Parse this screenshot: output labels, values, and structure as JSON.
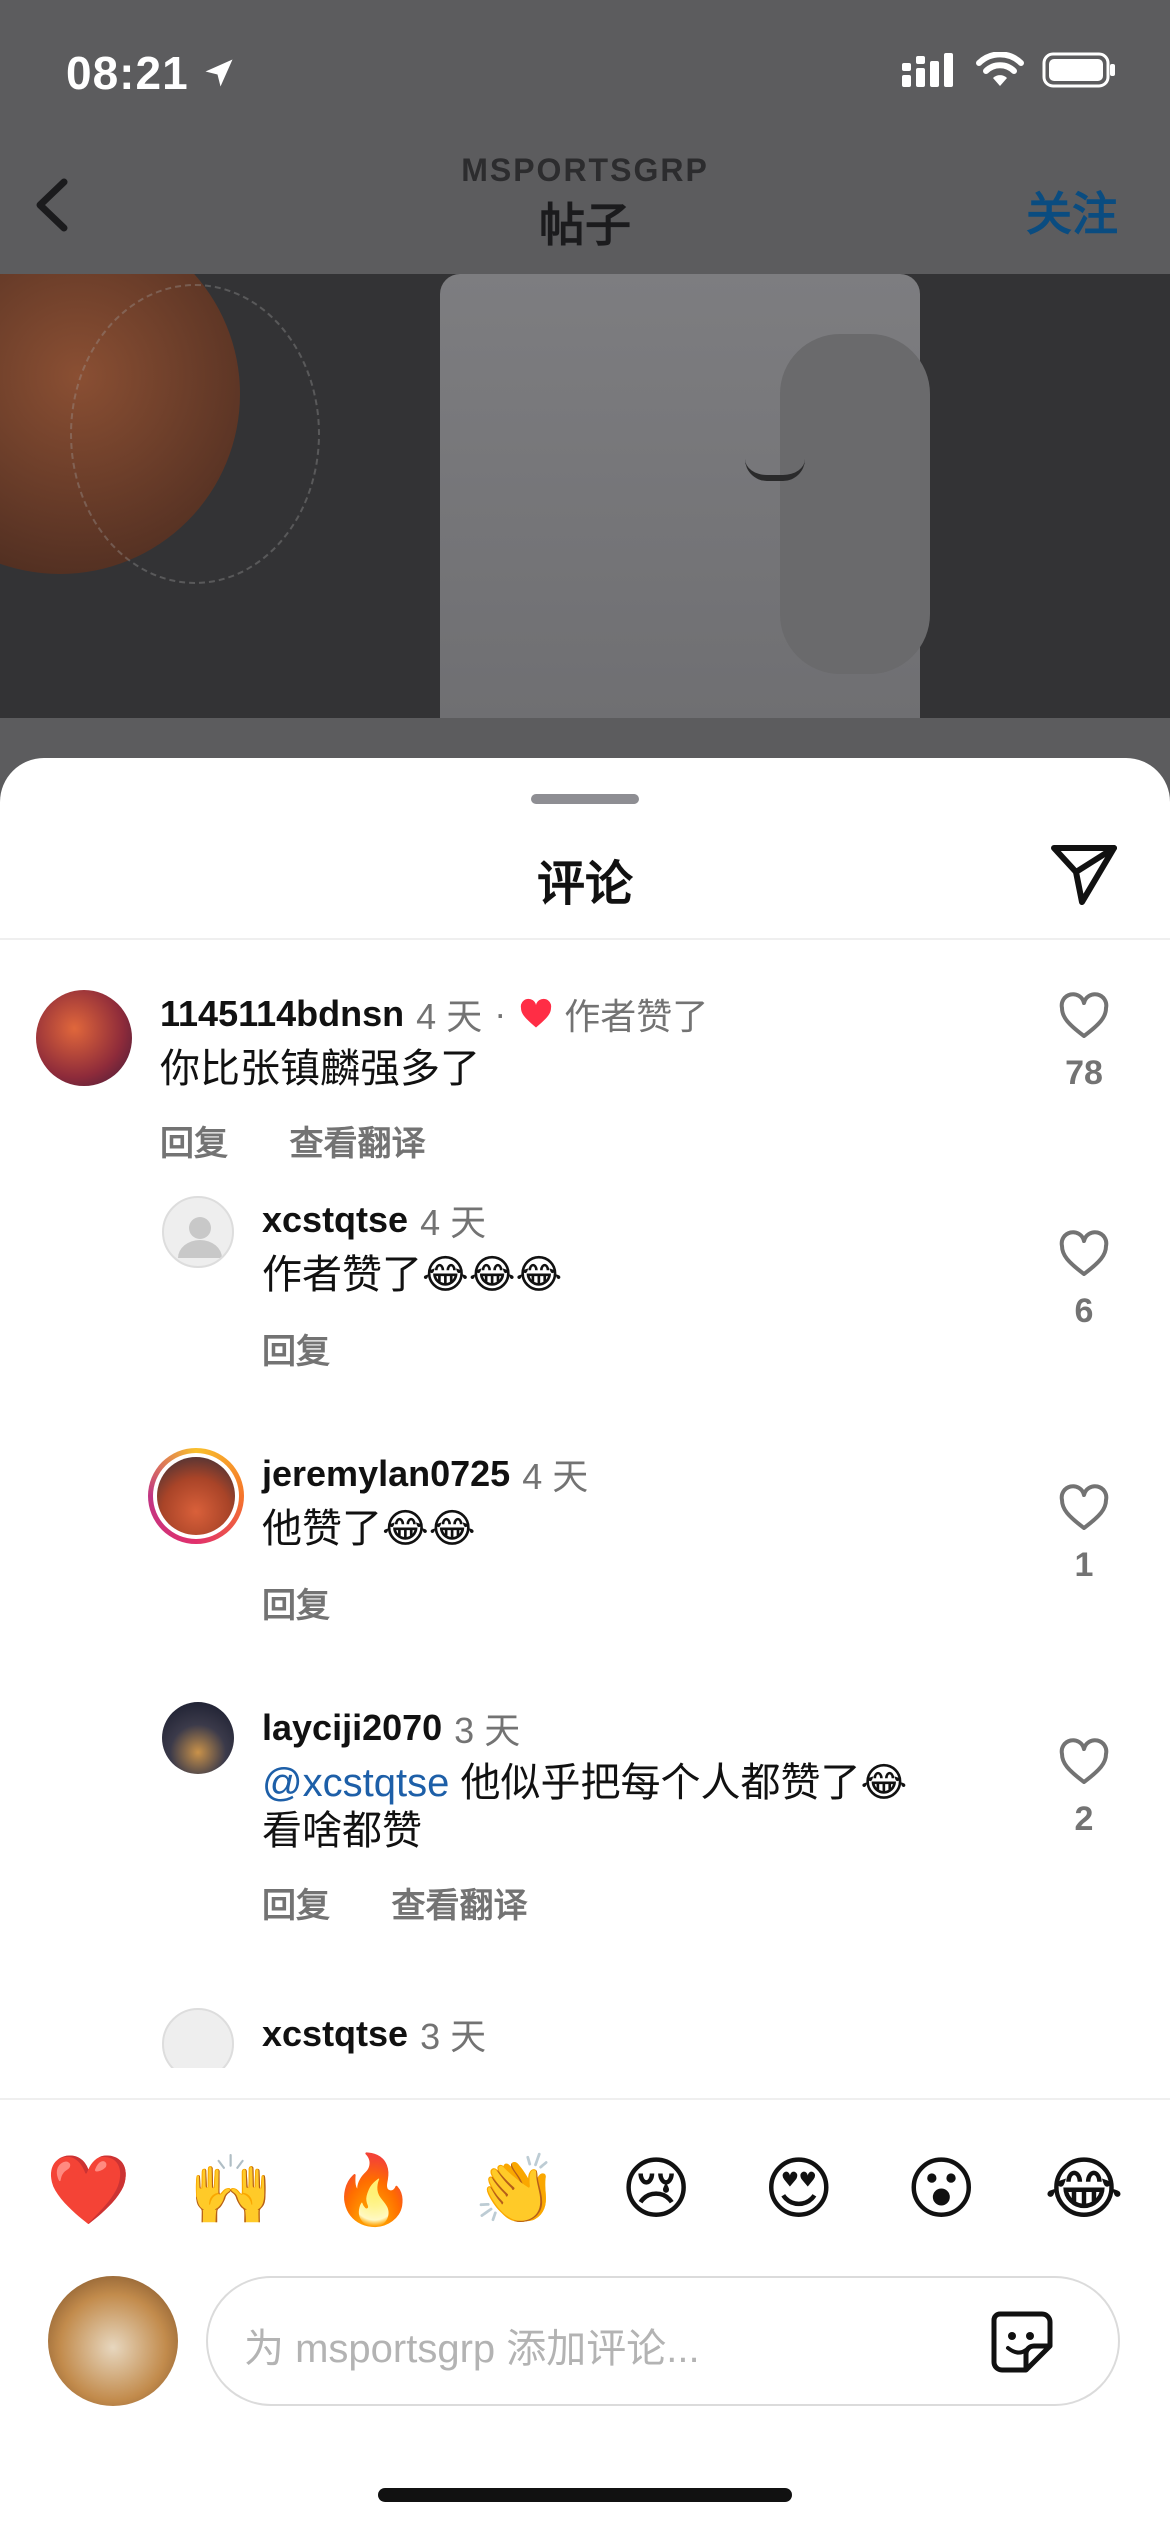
{
  "status_bar": {
    "time": "08:21"
  },
  "nav": {
    "account": "MSPORTSGRP",
    "title": "帖子",
    "follow_label": "关注"
  },
  "sheet": {
    "title": "评论"
  },
  "comments": [
    {
      "username": "1145114bdnsn",
      "time": "4 天",
      "author_liked": "作者赞了",
      "text": "你比张镇麟强多了",
      "reply_label": "回复",
      "translate_label": "查看翻译",
      "likes": "78"
    },
    {
      "username": "xcstqtse",
      "time": "4 天",
      "text": "作者赞了",
      "emojis": "😂😂😂",
      "reply_label": "回复",
      "likes": "6"
    },
    {
      "username": "jeremylan0725",
      "time": "4 天",
      "text": "他赞了",
      "emojis": "😂😂",
      "reply_label": "回复",
      "likes": "1"
    },
    {
      "username": "layciji2070",
      "time": "3 天",
      "mention": "@xcstqtse",
      "text": " 他似乎把每个人都赞了",
      "emojis": "😂",
      "text_line2": "看啥都赞",
      "reply_label": "回复",
      "translate_label": "查看翻译",
      "likes": "2"
    },
    {
      "username": "xcstqtse",
      "time": "3 天"
    }
  ],
  "quick_reactions": [
    "❤️",
    "🙌",
    "🔥",
    "👏",
    "😢",
    "😍",
    "😮",
    "😂"
  ],
  "composer": {
    "placeholder": "为 msportsgrp 添加评论..."
  },
  "colors": {
    "accent_blue": "#0a4c80",
    "mention_blue": "#1d5fa8",
    "like_red": "#ff2d45",
    "muted_text": "#737373"
  }
}
